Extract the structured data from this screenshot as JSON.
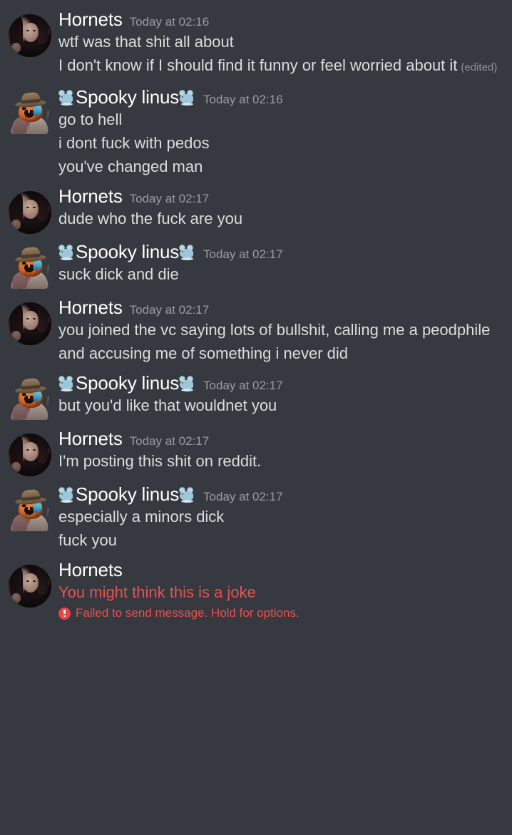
{
  "theme": {
    "background": "#36393f",
    "text": "#dcddde",
    "author": "#ffffff",
    "timestamp": "#9a9ca2",
    "error_red": "#e8514f",
    "error_icon": "#ed4245",
    "edited": "#8e9196"
  },
  "users": {
    "hornets": {
      "name": "Hornets",
      "avatar": "hornets-photo-avatar"
    },
    "spooky": {
      "name": "Spooky linus",
      "emoji_prefix": "mouse-emoji",
      "emoji_suffix": "mouse-emoji",
      "avatar": "pumpkin-head-avatar"
    }
  },
  "labels": {
    "edited": "(edited)",
    "failed_to_send": "Failed to send message. Hold for options.",
    "error_icon_name": "exclamation-circle-icon"
  },
  "messages": [
    {
      "author": "Hornets",
      "avatar": "hornets",
      "timestamp": "Today at 02:16",
      "lines": [
        {
          "text": "wtf was that shit all about"
        },
        {
          "text": "I don't know if I should find it funny or feel worried about it",
          "edited": true
        }
      ]
    },
    {
      "author": "Spooky linus",
      "avatar": "spooky",
      "timestamp": "Today at 02:16",
      "lines": [
        {
          "text": "go to hell"
        },
        {
          "text": "i dont fuck with pedos"
        },
        {
          "text": "you've changed man"
        }
      ]
    },
    {
      "author": "Hornets",
      "avatar": "hornets",
      "timestamp": "Today at 02:17",
      "lines": [
        {
          "text": "dude who the fuck are you"
        }
      ]
    },
    {
      "author": "Spooky linus",
      "avatar": "spooky",
      "timestamp": "Today at 02:17",
      "lines": [
        {
          "text": "suck dick and die"
        }
      ]
    },
    {
      "author": "Hornets",
      "avatar": "hornets",
      "timestamp": "Today at 02:17",
      "lines": [
        {
          "text": "you joined the vc saying lots of bullshit, calling me a peodphile and accusing me of something i never did"
        }
      ]
    },
    {
      "author": "Spooky linus",
      "avatar": "spooky",
      "timestamp": "Today at 02:17",
      "lines": [
        {
          "text": "but you'd like that wouldnet you"
        }
      ]
    },
    {
      "author": "Hornets",
      "avatar": "hornets",
      "timestamp": "Today at 02:17",
      "lines": [
        {
          "text": "I'm posting this shit on reddit."
        }
      ]
    },
    {
      "author": "Spooky linus",
      "avatar": "spooky",
      "timestamp": "Today at 02:17",
      "lines": [
        {
          "text": "especially a minors dick"
        },
        {
          "text": "fuck you"
        }
      ]
    },
    {
      "author": "Hornets",
      "avatar": "hornets",
      "timestamp": "",
      "lines": [
        {
          "text": "You might think this is a joke",
          "failed": true
        }
      ],
      "failed": true
    }
  ]
}
